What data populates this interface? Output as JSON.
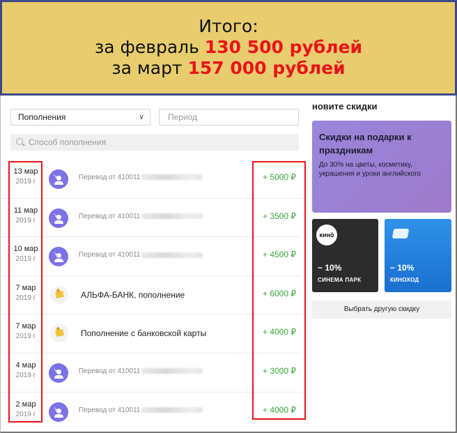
{
  "banner": {
    "line1": "Итого:",
    "feb_prefix": "за февраль ",
    "feb_amount": "130 500 рублей",
    "mar_prefix": "за март ",
    "mar_amount": "157 000 рублей"
  },
  "filters": {
    "type_select": "Пополнения",
    "period_placeholder": "Период",
    "method_placeholder": "Способ пополнения"
  },
  "transactions": [
    {
      "date": "13 мар",
      "year": "2019 г",
      "icon": "transfer-icon",
      "title": "Перевод от 410011",
      "amount": "+ 5000 ₽"
    },
    {
      "date": "11 мар",
      "year": "2019 г",
      "icon": "transfer-icon",
      "title": "Перевод от 410011",
      "amount": "+ 3500 ₽"
    },
    {
      "date": "10 мар",
      "year": "2019 г",
      "icon": "transfer-icon",
      "title": "Перевод от 410011",
      "amount": "+ 4500 ₽"
    },
    {
      "date": "7 мар",
      "year": "2019 г",
      "icon": "card-topup-icon",
      "title": "АЛЬФА-БАНК, пополнение",
      "amount": "+ 6000 ₽"
    },
    {
      "date": "7 мар",
      "year": "2019 г",
      "icon": "card-topup-icon",
      "title": "Пополнение с банковской карты",
      "amount": "+ 4000 ₽"
    },
    {
      "date": "4 мар",
      "year": "2019 г",
      "icon": "transfer-icon",
      "title": "Перевод от 410011",
      "amount": "+ 3000 ₽"
    },
    {
      "date": "2 мар",
      "year": "2019 г",
      "icon": "transfer-icon",
      "title": "Перевод от 410011",
      "amount": "+ 4000 ₽"
    }
  ],
  "sidebar": {
    "heading": "новите скидки",
    "promo_title": "Скидки на подарки к праздникам",
    "promo_sub": "До 30% на цветы, косметику, украшения и уроки английского",
    "card1_logo": "кинō",
    "card1_discount": "− 10%",
    "card1_name": "СИНЕМА ПАРК",
    "card2_discount": "− 10%",
    "card2_name": "КИНОХОД",
    "other_button": "Выбрать другую скидку"
  },
  "colors": {
    "banner_bg": "#e8cc6e",
    "banner_border": "#3d4a8a",
    "highlight_red": "#e8141a",
    "amount_green": "#3aa63a",
    "transfer_purple": "#7b72e6"
  }
}
